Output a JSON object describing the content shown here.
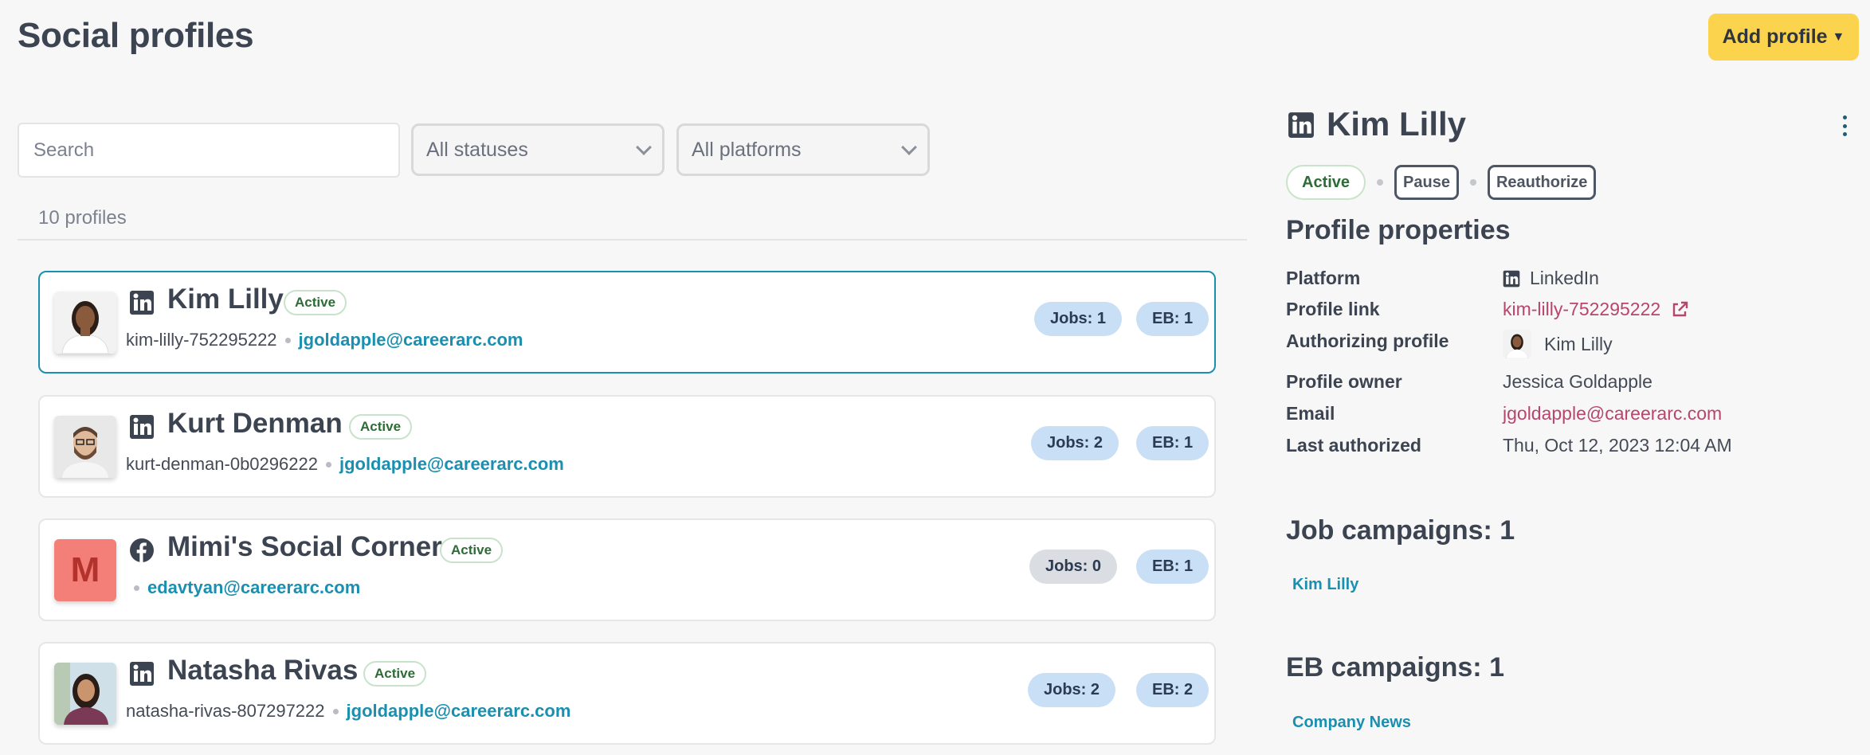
{
  "header": {
    "title": "Social profiles",
    "add_button": "Add profile"
  },
  "filters": {
    "search_placeholder": "Search",
    "status_select": "All statuses",
    "platform_select": "All platforms",
    "count": "10 profiles"
  },
  "profiles": [
    {
      "name": "Kim Lilly",
      "status": "Active",
      "handle": "kim-lilly-752295222",
      "email": "jgoldapple@careerarc.com",
      "jobs": "Jobs: 1",
      "eb": "EB: 1",
      "platform": "linkedin-icon"
    },
    {
      "name": "Kurt Denman",
      "status": "Active",
      "handle": "kurt-denman-0b0296222",
      "email": "jgoldapple@careerarc.com",
      "jobs": "Jobs: 2",
      "eb": "EB: 1",
      "platform": "linkedin-icon"
    },
    {
      "name": "Mimi's Social Corner",
      "status": "Active",
      "handle": "",
      "email": "edavtyan@careerarc.com",
      "jobs": "Jobs: 0",
      "eb": "EB: 1",
      "platform": "facebook-icon",
      "avatar_letter": "M"
    },
    {
      "name": "Natasha Rivas",
      "status": "Active",
      "handle": "natasha-rivas-807297222",
      "email": "jgoldapple@careerarc.com",
      "jobs": "Jobs: 2",
      "eb": "EB: 2",
      "platform": "linkedin-icon"
    }
  ],
  "detail": {
    "name": "Kim Lilly",
    "status": "Active",
    "pause_label": "Pause",
    "reauthorize_label": "Reauthorize",
    "properties_heading": "Profile properties",
    "properties": {
      "platform_label": "Platform",
      "platform_value": "LinkedIn",
      "profile_link_label": "Profile link",
      "profile_link_value": "kim-lilly-752295222",
      "authorizing_label": "Authorizing profile",
      "authorizing_value": "Kim Lilly",
      "owner_label": "Profile owner",
      "owner_value": "Jessica Goldapple",
      "email_label": "Email",
      "email_value": "jgoldapple@careerarc.com",
      "last_auth_label": "Last authorized",
      "last_auth_value": "Thu, Oct 12, 2023 12:04 AM"
    },
    "job_campaigns_heading": "Job campaigns: 1",
    "job_campaigns": [
      "Kim Lilly"
    ],
    "eb_campaigns_heading": "EB campaigns: 1",
    "eb_campaigns": [
      "Company News"
    ]
  },
  "colors": {
    "accent_yellow": "#fcd34d",
    "link_teal": "#1b8fb0",
    "link_rose": "#b8456c",
    "badge_blue": "#c9dff5",
    "status_green": "#2f6b37"
  }
}
